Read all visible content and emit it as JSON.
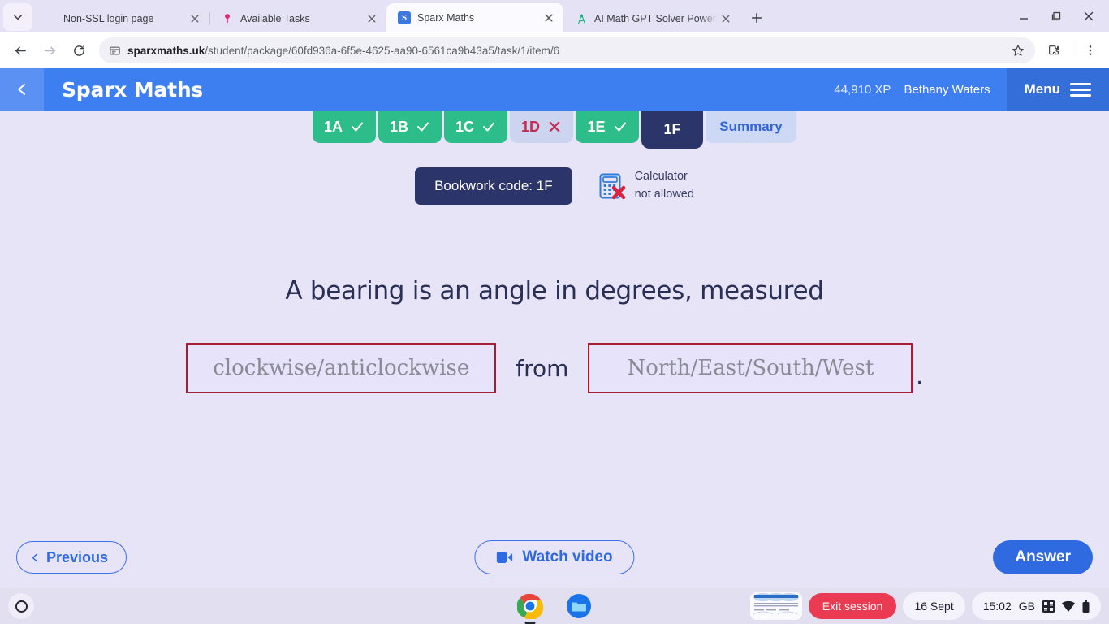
{
  "browser": {
    "tabs": [
      {
        "title": "Non-SSL login page",
        "favicon": "blank-icon",
        "active": false
      },
      {
        "title": "Available Tasks",
        "favicon": "pink-pin-icon",
        "active": false
      },
      {
        "title": "Sparx Maths",
        "favicon": "sparx-s-icon",
        "favicon_letter": "S",
        "active": true
      },
      {
        "title": "AI Math GPT Solver Powered b",
        "favicon": "green-compass-icon",
        "active": false
      }
    ],
    "new_tab_label": "+",
    "omnibox": {
      "domain": "sparxmaths.uk",
      "path": "/student/package/60fd936a-6f5e-4625-aa90-6561ca9b43a5/task/1/item/6"
    },
    "toolbar_icons": [
      "back-icon",
      "forward-icon",
      "reload-icon",
      "page-info-icon",
      "bookmark-star-icon",
      "extensions-icon",
      "chrome-menu-icon"
    ],
    "window_controls": [
      "minimize-icon",
      "maximize-icon",
      "close-icon"
    ]
  },
  "app": {
    "brand": "Sparx Maths",
    "xp": "44,910 XP",
    "user": "Bethany Waters",
    "menu_label": "Menu",
    "task_tabs": [
      {
        "label": "1A",
        "state": "correct",
        "mark": "check"
      },
      {
        "label": "1B",
        "state": "correct",
        "mark": "check"
      },
      {
        "label": "1C",
        "state": "correct",
        "mark": "check"
      },
      {
        "label": "1D",
        "state": "wrong",
        "mark": "cross"
      },
      {
        "label": "1E",
        "state": "correct",
        "mark": "check"
      },
      {
        "label": "1F",
        "state": "current",
        "mark": "none"
      },
      {
        "label": "Summary",
        "state": "summary",
        "mark": "none"
      }
    ],
    "bookwork_code": "Bookwork code: 1F",
    "calculator": {
      "line1": "Calculator",
      "line2": "not allowed"
    },
    "question": {
      "prompt": "A bearing is an angle in degrees, measured",
      "input1_placeholder": "clockwise/anticlockwise",
      "input1_value": "",
      "join_word": "from",
      "input2_placeholder": "North/East/South/West",
      "input2_value": "",
      "trailing": "."
    },
    "actions": {
      "previous": "Previous",
      "watch_video": "Watch video",
      "answer": "Answer"
    },
    "colors": {
      "header_blue": "#3d7ef0",
      "tab_green": "#2dbd8a",
      "tab_wrong_text": "#c12d4e",
      "tab_current_navy": "#2c3569",
      "page_bg": "#e8e4f8",
      "input_border_red": "#a81c35",
      "accent_blue": "#2f6ae0"
    }
  },
  "shelf": {
    "launcher": "launcher-icon",
    "apps": [
      {
        "name": "chrome-icon",
        "running": true
      },
      {
        "name": "files-icon",
        "running": false
      }
    ],
    "thumbnail": "screen-thumbnail",
    "exit_session": "Exit session",
    "date": "16 Sept",
    "time": "15:02",
    "locale": "GB",
    "status_icons": [
      "ime-icon",
      "wifi-icon",
      "battery-icon"
    ]
  }
}
